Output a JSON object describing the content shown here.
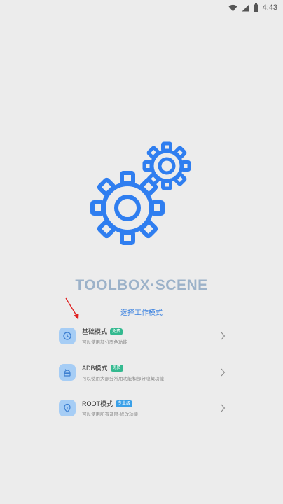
{
  "status_bar": {
    "time": "4:43",
    "icons": [
      "wifi-icon",
      "signal-icon",
      "battery-icon"
    ]
  },
  "app": {
    "title": "TOOLBOX·SCENE",
    "subtitle": "选择工作模式"
  },
  "modes": [
    {
      "name": "基础模式",
      "badge": "免费",
      "description": "可以使用部分面色功能",
      "icon": "clock-icon"
    },
    {
      "name": "ADB模式",
      "badge": "免费",
      "description": "可以使用大部分常用功能和部分隐藏功能",
      "icon": "android-icon"
    },
    {
      "name": "ROOT模式",
      "badge": "专业级",
      "description": "可以使用所有调度·修改功能",
      "icon": "shield-icon"
    }
  ],
  "colors": {
    "accent": "#2f7ef0",
    "badge_free": "#33b98f",
    "badge_pro": "#3aa0e8",
    "icon_bg": "#a6cdf5",
    "background": "#ececec",
    "annotation_arrow": "#e02020"
  }
}
